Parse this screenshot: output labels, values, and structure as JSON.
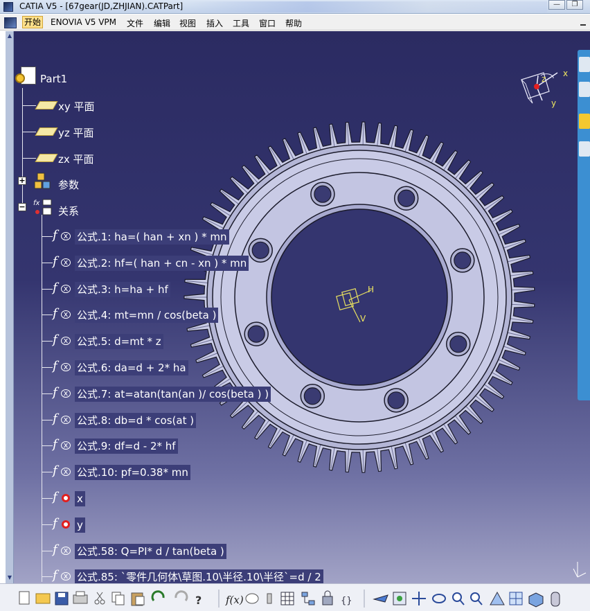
{
  "window": {
    "title": "CATIA V5 - [67gear(JD,ZHJIAN).CATPart]",
    "minimize_label": "—",
    "restore_label": "❐"
  },
  "menu": {
    "items": [
      "开始",
      "ENOVIA V5 VPM",
      "文件",
      "编辑",
      "视图",
      "插入",
      "工具",
      "窗口",
      "帮助"
    ]
  },
  "tree": {
    "root": "Part1",
    "planes": [
      "xy 平面",
      "yz 平面",
      "zx 平面"
    ],
    "parameters": "参数",
    "relations": "关系",
    "formulas": [
      "公式.1: ha=( han + xn ) * mn",
      "公式.2: hf=( han + cn - xn ) * mn",
      "公式.3: h=ha + hf",
      "公式.4: mt=mn / cos(beta )",
      "公式.5: d=mt * z",
      "公式.6: da=d + 2* ha",
      "公式.7: at=atan(tan(an )/ cos(beta ) )",
      "公式.8: db=d * cos(at )",
      "公式.9: df=d - 2* hf",
      "公式.10: pf=0.38* mn"
    ],
    "laws": [
      "x",
      "y"
    ],
    "more_formulas": [
      "公式.58: Q=PI* d / tan(beta )",
      "公式.85: `零件几何体\\草图.10\\半径.10\\半径`=d / 2"
    ]
  },
  "compass": {
    "x_label": "x",
    "y_label": "y",
    "z_label": "z"
  },
  "axis_origin": {
    "h_label": "H",
    "v_label": "V"
  },
  "gear": {
    "teeth": 67,
    "holes": 8,
    "color": "#c9cbe6"
  },
  "colors": {
    "viewport_top": "#2b2b62",
    "viewport_bottom": "#a2a3c6",
    "tree_text": "#ffffff"
  }
}
